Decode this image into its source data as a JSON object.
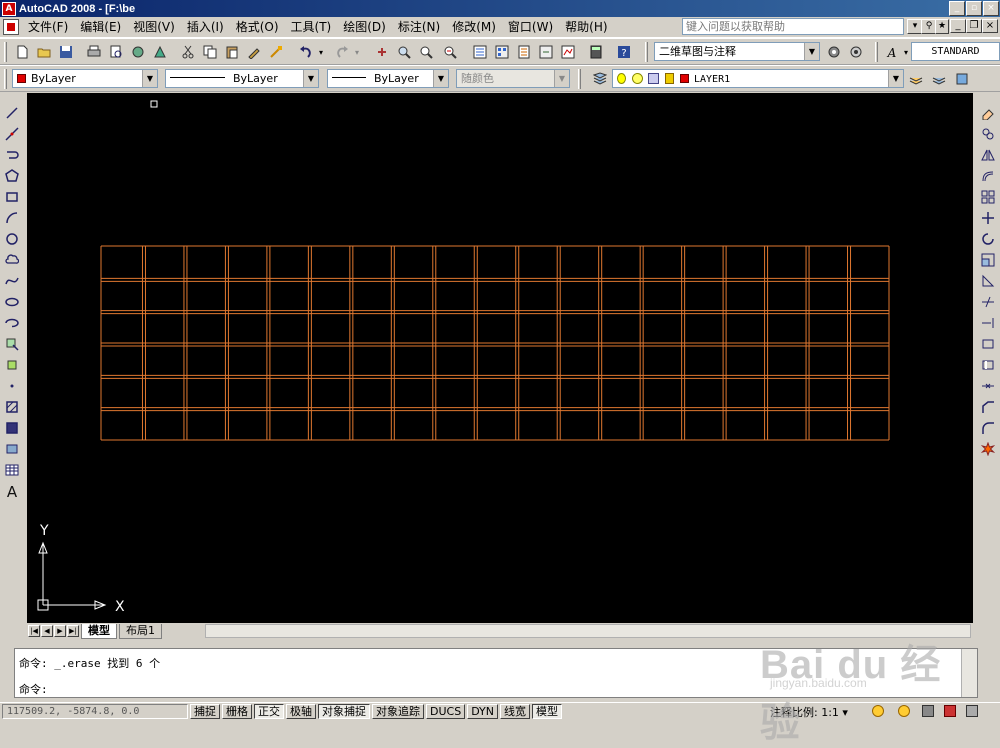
{
  "app": {
    "title": "AutoCAD 2008 - [F:\\be",
    "icon_label": "A"
  },
  "menu": {
    "items": [
      "文件(F)",
      "编辑(E)",
      "视图(V)",
      "插入(I)",
      "格式(O)",
      "工具(T)",
      "绘图(D)",
      "标注(N)",
      "修改(M)",
      "窗口(W)",
      "帮助(H)"
    ],
    "help_placeholder": "键入问题以获取帮助"
  },
  "toolbar1": {
    "workspace": "二维草图与注释",
    "text_style": "STANDARD"
  },
  "toolbar2": {
    "color": "ByLayer",
    "linetype": "ByLayer",
    "lineweight": "ByLayer",
    "plotstyle": "随颜色",
    "layer": "LAYER1",
    "layer_color": "#e00000"
  },
  "canvas": {
    "background": "#000000",
    "grid_color": "#e07830",
    "grid_columns": 19,
    "grid_rows": 6,
    "ucs_x_label": "X",
    "ucs_y_label": "Y"
  },
  "layout_tabs": {
    "tabs": [
      "模型",
      "布局1"
    ],
    "active": 0
  },
  "command": {
    "line1_prompt": "命令:",
    "line1_text": "_.erase 找到 6 个",
    "line2_prompt": "命令:"
  },
  "status": {
    "coords": "117509.2, -5874.8, 0.0",
    "buttons": [
      {
        "label": "捕捉",
        "on": false
      },
      {
        "label": "栅格",
        "on": false
      },
      {
        "label": "正交",
        "on": true
      },
      {
        "label": "极轴",
        "on": false
      },
      {
        "label": "对象捕捉",
        "on": true
      },
      {
        "label": "对象追踪",
        "on": false
      },
      {
        "label": "DUCS",
        "on": false
      },
      {
        "label": "DYN",
        "on": false
      },
      {
        "label": "线宽",
        "on": false
      },
      {
        "label": "模型",
        "on": true
      }
    ],
    "annotation_scale_label": "注释比例:",
    "annotation_scale_value": "1:1"
  },
  "watermark": {
    "logo": "Bai du 经验",
    "sub": "jingyan.baidu.com"
  }
}
